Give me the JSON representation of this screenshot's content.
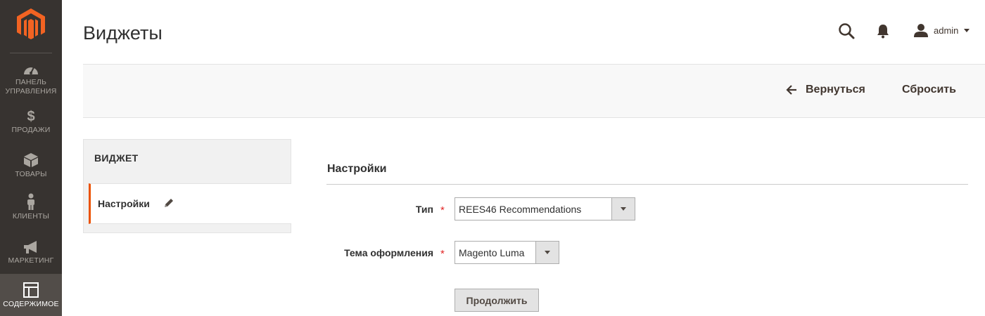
{
  "sidebar": {
    "items": [
      {
        "label": "ПАНЕЛЬ УПРАВЛЕНИЯ",
        "icon": "dashboard-icon"
      },
      {
        "label": "ПРОДАЖИ",
        "icon": "dollar-icon"
      },
      {
        "label": "ТОВАРЫ",
        "icon": "box-icon"
      },
      {
        "label": "КЛИЕНТЫ",
        "icon": "user-icon"
      },
      {
        "label": "МАРКЕТИНГ",
        "icon": "megaphone-icon"
      },
      {
        "label": "СОДЕРЖИМОЕ",
        "icon": "layout-icon",
        "active": true
      }
    ],
    "logo_color": "#f26322"
  },
  "header": {
    "title": "Виджеты",
    "user_name": "admin"
  },
  "actions": {
    "back_label": "Вернуться",
    "reset_label": "Сбросить"
  },
  "tabs": {
    "title": "ВИДЖЕТ",
    "items": [
      {
        "label": "Настройки",
        "active": true
      }
    ]
  },
  "form": {
    "section_title": "Настройки",
    "fields": [
      {
        "label": "Тип",
        "required_mark": "*",
        "value": "REES46 Recommendations"
      },
      {
        "label": "Тема оформления",
        "required_mark": "*",
        "value": "Magento Luma"
      }
    ],
    "continue_label": "Продолжить"
  },
  "colors": {
    "accent": "#eb5202",
    "sidebar_bg": "#373330",
    "required": "#e22626"
  }
}
